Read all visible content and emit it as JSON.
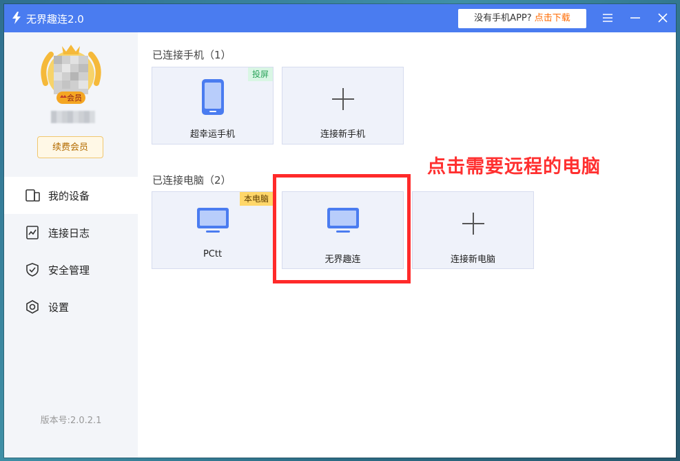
{
  "app": {
    "title": "无界趣连2.0"
  },
  "titlebar": {
    "download_prompt": "没有手机APP?",
    "download_link": "点击下载"
  },
  "sidebar": {
    "member_badge": "会员",
    "renew_label": "续费会员",
    "nav": [
      {
        "label": "我的设备",
        "icon": "device-icon",
        "active": true
      },
      {
        "label": "连接日志",
        "icon": "log-icon",
        "active": false
      },
      {
        "label": "安全管理",
        "icon": "shield-icon",
        "active": false
      },
      {
        "label": "设置",
        "icon": "gear-icon",
        "active": false
      }
    ],
    "version": "版本号:2.0.2.1"
  },
  "phones": {
    "section_title": "已连接手机（1）",
    "items": [
      {
        "name": "超幸运手机",
        "badge": "投屏"
      }
    ],
    "add_label": "连接新手机"
  },
  "computers": {
    "section_title": "已连接电脑（2）",
    "items": [
      {
        "name": "PCtt",
        "badge": "本电脑"
      },
      {
        "name": "无界趣连",
        "badge": ""
      }
    ],
    "add_label": "连接新电脑"
  },
  "annotation": {
    "text": "点击需要远程的电脑",
    "color": "#ff2a2a"
  },
  "colors": {
    "titlebar": "#4a7cf0",
    "accent_orange": "#ff6a00",
    "card_bg": "#eff2fa"
  }
}
